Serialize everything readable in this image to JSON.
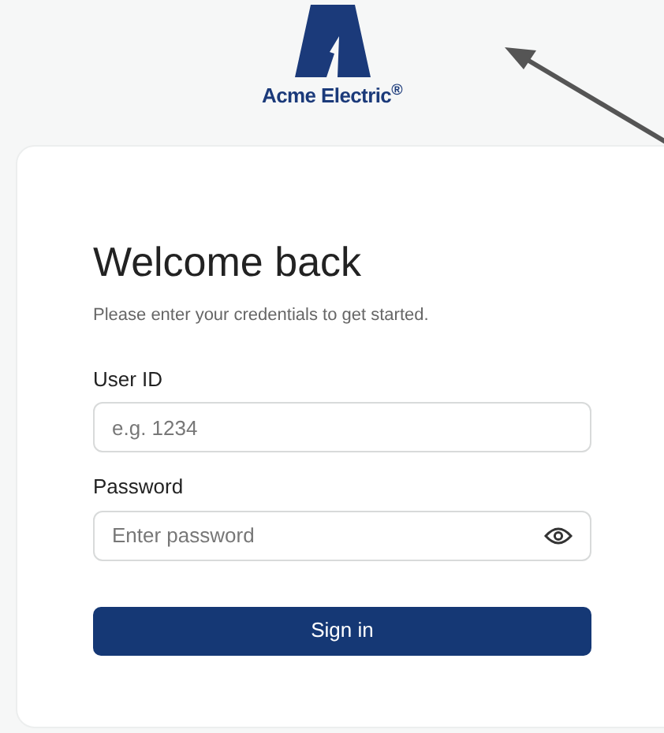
{
  "logo": {
    "text": "Acme Electric$^{®}$"
  },
  "login": {
    "title": "Welcome back",
    "subtitle": "Please enter your credentials to get started.",
    "fields": [
      {
        "label": "User ID",
        "placeholder": "e.g. 1234",
        "kind": "text"
      },
      {
        "label": "Password",
        "placeholder": "Enter password",
        "kind": "password"
      }
    ],
    "submit": "Sign in"
  }
}
